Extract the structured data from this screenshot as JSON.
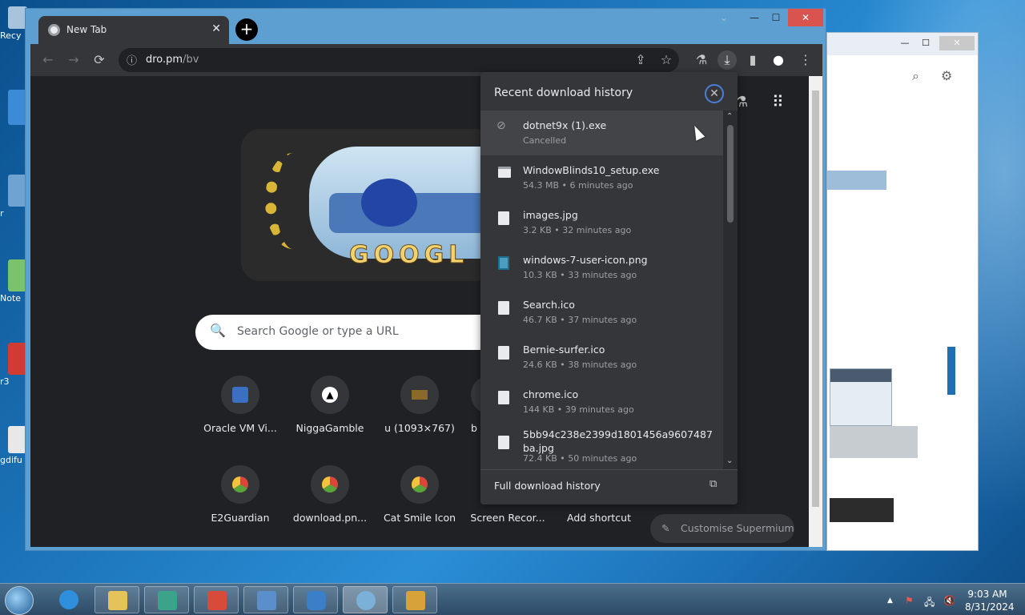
{
  "desktop": {
    "icons": [
      {
        "label": "Recy",
        "color": "#a8c4dc"
      },
      {
        "label": "",
        "color": "#3d8ad6"
      },
      {
        "label": "r",
        "color": "#6fa3d2"
      },
      {
        "label": "Note",
        "color": "#7bc36b"
      },
      {
        "label": "r3",
        "color": "#d23b32"
      },
      {
        "label": "gdifu",
        "color": "#e8e8e8"
      }
    ]
  },
  "window": {
    "minimize": "—",
    "maximize": "☐",
    "close": "✕",
    "dropdown": "⌄"
  },
  "tab": {
    "title": "New Tab",
    "close": "✕",
    "new_tab": "+"
  },
  "toolbar": {
    "back": "←",
    "forward": "→",
    "reload": "⟳",
    "url_host": "dro.pm",
    "url_path": "/bv",
    "info_icon": "ⓘ",
    "share": "⇪",
    "star": "☆",
    "labs": "⚗",
    "download": "⤓",
    "sidepanel": "▮",
    "profile": "●",
    "menu": "⋮"
  },
  "ntp": {
    "search_placeholder": "Search Google or type a URL",
    "search_icon": "🔍",
    "doodle_text": "GOOGL",
    "labs_icon": "⚗",
    "apps_icon": "⠿",
    "shortcuts": [
      {
        "label": "Oracle VM Vi...",
        "icon": "oracle-vm-icon",
        "color": "#3b6fc2"
      },
      {
        "label": "NiggaGamble",
        "icon": "triangle-icon",
        "color": "#000000"
      },
      {
        "label": "u (1093×767)",
        "icon": "boot-icon",
        "color": "#8a6a2a"
      },
      {
        "label": "b",
        "icon": "site-icon",
        "color": "#35363a"
      },
      {
        "label": "E2Guardian",
        "icon": "globe-icon",
        "color": "#5aa33a"
      },
      {
        "label": "download.pn...",
        "icon": "globe-icon",
        "color": "#5aa33a"
      },
      {
        "label": "Cat Smile Icon",
        "icon": "globe-icon",
        "color": "#5aa33a"
      },
      {
        "label": "Screen Recor...",
        "icon": "globe-icon",
        "color": "#5aa33a"
      },
      {
        "label": "Add shortcut",
        "icon": "plus-icon",
        "color": "#35363a"
      }
    ],
    "customise_label": "Customise Supermium",
    "customise_icon": "✎"
  },
  "downloads": {
    "title": "Recent download history",
    "close": "✕",
    "items": [
      {
        "name": "dotnet9x (1).exe",
        "status": "Cancelled",
        "icon": "cancelled-icon"
      },
      {
        "name": "WindowBlinds10_setup.exe",
        "status": "54.3 MB • 6 minutes ago",
        "icon": "exe-icon"
      },
      {
        "name": "images.jpg",
        "status": "3.2 KB • 32 minutes ago",
        "icon": "file-icon"
      },
      {
        "name": "windows-7-user-icon.png",
        "status": "10.3 KB • 33 minutes ago",
        "icon": "image-icon"
      },
      {
        "name": "Search.ico",
        "status": "46.7 KB • 37 minutes ago",
        "icon": "file-icon"
      },
      {
        "name": "Bernie-surfer.ico",
        "status": "24.6 KB • 38 minutes ago",
        "icon": "file-icon"
      },
      {
        "name": "chrome.ico",
        "status": "144 KB • 39 minutes ago",
        "icon": "file-icon"
      },
      {
        "name": "5bb94c238e2399d1801456a9607487ba.jpg",
        "status": "72.4 KB • 50 minutes ago",
        "icon": "file-icon"
      }
    ],
    "full_history": "Full download history",
    "open_icon": "⧉"
  },
  "taskbar": {
    "apps": [
      {
        "name": "Internet Explorer",
        "color": "#2f8fdc"
      },
      {
        "name": "File Explorer",
        "color": "#e6c25a"
      },
      {
        "name": "App",
        "color": "#3aa38a"
      },
      {
        "name": "App",
        "color": "#d84a3a"
      },
      {
        "name": "Control Panel",
        "color": "#5b8fcc"
      },
      {
        "name": "Search",
        "color": "#3a7fc8"
      },
      {
        "name": "Supermium",
        "color": "#7bb0d8"
      },
      {
        "name": "Explorer",
        "color": "#d8a23a"
      }
    ],
    "time": "9:03 AM",
    "date": "8/31/2024",
    "tray_arrow": "▲",
    "tray_flag": "⚑",
    "tray_network": "🖧",
    "tray_volume": "🔇"
  },
  "bgwindow": {
    "minimize": "—",
    "maximize": "☐",
    "close": "✕",
    "search_icon": "⌕",
    "gear_icon": "⚙"
  }
}
